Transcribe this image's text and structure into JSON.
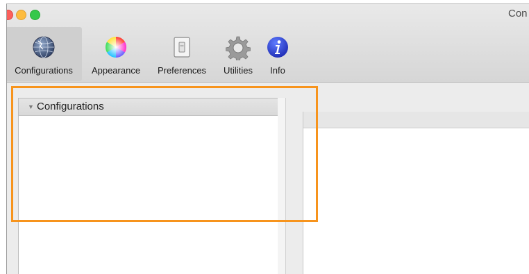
{
  "window": {
    "title": "Con",
    "traffic_lights": {
      "close_color": "#fc605c",
      "minimize_color": "#fdbc40",
      "zoom_color": "#34c84a"
    }
  },
  "toolbar": {
    "items": [
      {
        "label": "Configurations",
        "icon": "globe-icon",
        "selected": true
      },
      {
        "label": "Appearance",
        "icon": "color-wheel-icon",
        "selected": false
      },
      {
        "label": "Preferences",
        "icon": "switch-icon",
        "selected": false
      },
      {
        "label": "Utilities",
        "icon": "gear-icon",
        "selected": false
      },
      {
        "label": "Info",
        "icon": "info-icon",
        "selected": false
      }
    ]
  },
  "sidebar": {
    "section_title": "Configurations",
    "expanded": true
  },
  "highlight": {
    "color": "#f7941d"
  }
}
